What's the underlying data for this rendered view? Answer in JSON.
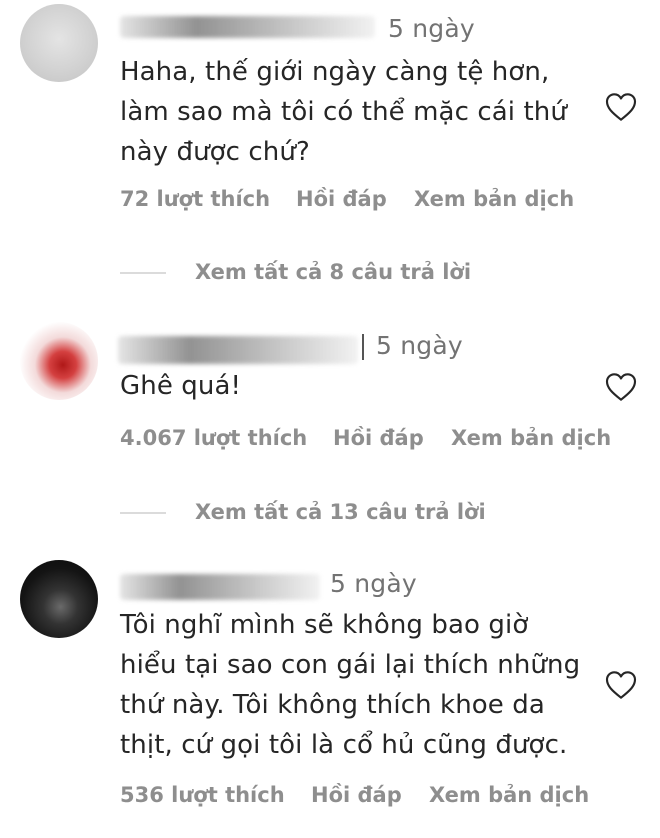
{
  "comments": [
    {
      "time": "5 ngày",
      "text": "Haha, thế giới ngày càng tệ hơn,\nlàm sao mà tôi có thể mặc cái thứ\nnày được chứ?",
      "likes": "72 lượt thích",
      "reply": "Hồi đáp",
      "translate": "Xem bản dịch",
      "view_replies": "Xem tất cả 8 câu trả lời"
    },
    {
      "time": "5 ngày",
      "text": "Ghê quá!",
      "likes": "4.067 lượt thích",
      "reply": "Hồi đáp",
      "translate": "Xem bản dịch",
      "view_replies": "Xem tất cả 13 câu trả lời"
    },
    {
      "time": "5 ngày",
      "text": "Tôi nghĩ mình sẽ không bao giờ\nhiểu tại sao con gái lại thích những\nthứ này. Tôi không thích khoe da\nthịt, cứ gọi tôi là cổ hủ cũng được.",
      "likes": "536 lượt thích",
      "reply": "Hồi đáp",
      "translate": "Xem bản dịch"
    }
  ],
  "icons": {
    "like": "heart-outline-icon"
  }
}
